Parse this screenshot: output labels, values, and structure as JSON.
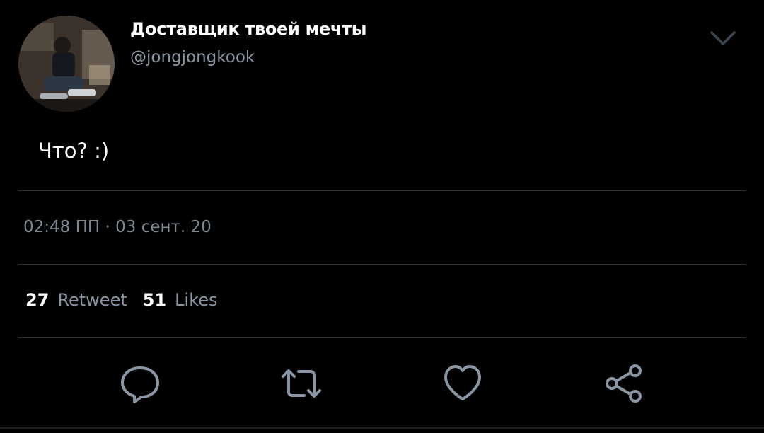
{
  "tweet": {
    "author": {
      "display_name": "Доставщик твоей мечты",
      "handle": "@jongjongkook"
    },
    "text": "Что? :)",
    "timestamp": "02:48 ПП · 03 сент. 20",
    "stats": {
      "retweets_count": "27",
      "retweets_label": "Retweet",
      "likes_count": "51",
      "likes_label": "Likes"
    }
  },
  "actions": {
    "reply_icon": "reply-bubble",
    "retweet_icon": "retweet-arrows",
    "like_icon": "heart",
    "share_icon": "share-nodes"
  },
  "colors": {
    "background": "#000000",
    "primary_text": "#ffffff",
    "secondary_text": "#8a96a3",
    "divider": "#2b2f33",
    "icon": "#8a96a3"
  }
}
